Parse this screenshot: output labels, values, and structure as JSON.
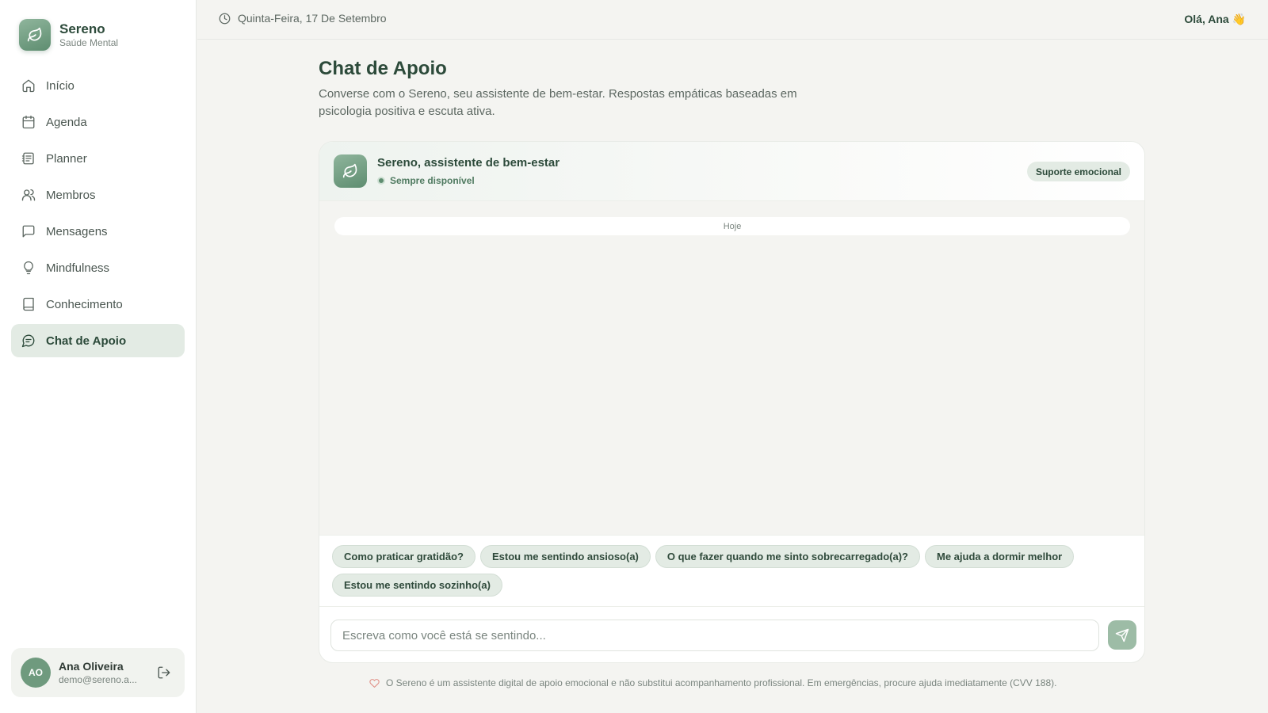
{
  "brand": {
    "name": "Sereno",
    "subtitle": "Saúde Mental"
  },
  "nav": {
    "items": [
      {
        "label": "Início",
        "icon": "home-icon",
        "active": false
      },
      {
        "label": "Agenda",
        "icon": "calendar-icon",
        "active": false
      },
      {
        "label": "Planner",
        "icon": "planner-icon",
        "active": false
      },
      {
        "label": "Membros",
        "icon": "users-icon",
        "active": false
      },
      {
        "label": "Mensagens",
        "icon": "message-icon",
        "active": false
      },
      {
        "label": "Mindfulness",
        "icon": "lightbulb-icon",
        "active": false
      },
      {
        "label": "Conhecimento",
        "icon": "book-icon",
        "active": false
      },
      {
        "label": "Chat de Apoio",
        "icon": "chat-icon",
        "active": true
      }
    ]
  },
  "user": {
    "initials": "AO",
    "name": "Ana Oliveira",
    "email": "demo@sereno.a..."
  },
  "topbar": {
    "date": "Quinta-Feira, 17 De Setembro",
    "greeting": "Olá, Ana 👋"
  },
  "page": {
    "title": "Chat de Apoio",
    "description": "Converse com o Sereno, seu assistente de bem-estar. Respostas empáticas baseadas em psicologia positiva e escuta ativa."
  },
  "chat": {
    "bot_name": "Sereno, assistente de bem-estar",
    "status": "Sempre disponível",
    "badge": "Suporte emocional",
    "day_separator": "Hoje",
    "suggestions": [
      "Como praticar gratidão?",
      "Estou me sentindo ansioso(a)",
      "O que fazer quando me sinto sobrecarregado(a)?",
      "Me ajuda a dormir melhor",
      "Estou me sentindo sozinho(a)"
    ],
    "input_placeholder": "Escreva como você está se sentindo...",
    "input_value": ""
  },
  "disclaimer": "O Sereno é um assistente digital de apoio emocional e não substitui acompanhamento profissional. Em emergências, procure ajuda imediatamente (CVV 188).",
  "colors": {
    "accent": "#5e8d70",
    "accent_light": "#e3ebe4",
    "title": "#2c4a3a",
    "background": "#f4f4f1"
  }
}
